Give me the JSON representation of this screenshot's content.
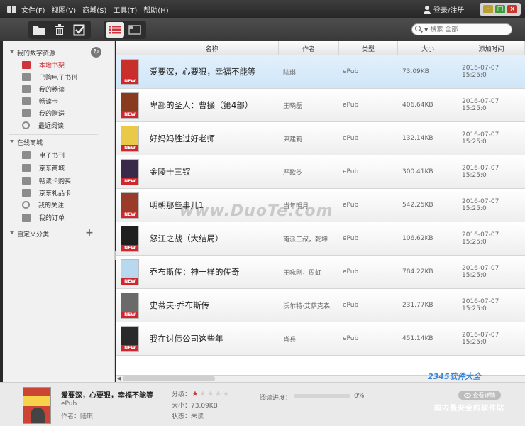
{
  "menu": [
    "文件(F)",
    "视图(V)",
    "商城(S)",
    "工具(T)",
    "帮助(H)"
  ],
  "login_label": "登录/注册",
  "search": {
    "placeholder": "搜索 全部"
  },
  "sidebar": {
    "sections": [
      {
        "label": "我的数字资源"
      },
      {
        "label": "在线商城"
      },
      {
        "label": "自定义分类"
      }
    ],
    "my_items": [
      {
        "label": "本地书架",
        "icon": "bookshelf-icon"
      },
      {
        "label": "已购电子书刊",
        "icon": "purchased-icon"
      },
      {
        "label": "我的畅读",
        "icon": "reading-icon"
      },
      {
        "label": "畅读卡",
        "icon": "card-icon"
      },
      {
        "label": "我的赠送",
        "icon": "gift-icon"
      },
      {
        "label": "最近阅读",
        "icon": "clock-icon"
      }
    ],
    "shop_items": [
      {
        "label": "电子书刊",
        "icon": "ebook-icon"
      },
      {
        "label": "京东商城",
        "icon": "store-icon"
      },
      {
        "label": "畅读卡购买",
        "icon": "card-buy-icon"
      },
      {
        "label": "京东礼品卡",
        "icon": "gift-card-icon"
      },
      {
        "label": "我的关注",
        "icon": "heart-icon"
      },
      {
        "label": "我的订单",
        "icon": "order-icon"
      }
    ]
  },
  "table": {
    "headers": [
      "名称",
      "作者",
      "类型",
      "大小",
      "添加时间"
    ],
    "badge": "NEW",
    "rows": [
      {
        "title": "爱要深，心要狠，幸福不能等",
        "author": "陆琪",
        "type": "ePub",
        "size": "73.09KB",
        "added": "2016-07-07 15:25:0"
      },
      {
        "title": "卑鄙的圣人：曹操（第4部）",
        "author": "王晓磊",
        "type": "ePub",
        "size": "406.64KB",
        "added": "2016-07-07 15:25:0"
      },
      {
        "title": "好妈妈胜过好老师",
        "author": "尹建莉",
        "type": "ePub",
        "size": "132.14KB",
        "added": "2016-07-07 15:25:0"
      },
      {
        "title": "金陵十三钗",
        "author": "严歌苓",
        "type": "ePub",
        "size": "300.41KB",
        "added": "2016-07-07 15:25:0"
      },
      {
        "title": "明朝那些事儿1",
        "author": "当年明月",
        "type": "ePub",
        "size": "542.25KB",
        "added": "2016-07-07 15:25:0"
      },
      {
        "title": "怒江之战（大结局）",
        "author": "南派三叔，乾坤",
        "type": "ePub",
        "size": "106.62KB",
        "added": "2016-07-07 15:25:0"
      },
      {
        "title": "乔布斯传：神一样的传奇",
        "author": "王咏刚，周虹",
        "type": "ePub",
        "size": "784.22KB",
        "added": "2016-07-07 15:25:0"
      },
      {
        "title": "史蒂夫·乔布斯传",
        "author": "沃尔特·艾萨克森",
        "type": "ePub",
        "size": "231.77KB",
        "added": "2016-07-07 15:25:0"
      },
      {
        "title": "我在讨债公司这些年",
        "author": "肖兵",
        "type": "ePub",
        "size": "451.14KB",
        "added": "2016-07-07 15:25:0"
      }
    ],
    "cover_colors": [
      "#c9302c",
      "#8a3a1f",
      "#e8c94a",
      "#3a2a4a",
      "#9a3a2a",
      "#1f1f1f",
      "#b8d8f0",
      "#6a6a6a",
      "#2a2a2a"
    ]
  },
  "watermark": "www.DuoTe.com",
  "detail": {
    "title": "爱要深，心要狠，幸福不能等",
    "format": "ePub",
    "author": "作者：陆琪",
    "rating_label": "分级：",
    "rating": 1,
    "rating_max": 5,
    "size": "大小：73.09KB",
    "status": "状态：未读",
    "progress_label": "阅读进度：",
    "progress": 0,
    "progress_text": "0%",
    "view_detail": "查看详情"
  },
  "brand": {
    "name": "2345软件大全",
    "tagline": "国内最安全的软件站"
  },
  "colors": {
    "accent": "#d0343b",
    "selected_row": "#d9ecfa"
  }
}
